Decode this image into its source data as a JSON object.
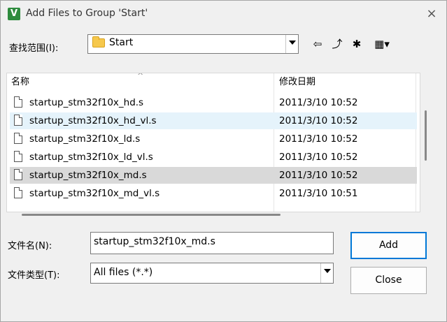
{
  "window": {
    "title": "Add Files to Group 'Start'",
    "app_icon_glyph": "V",
    "close_glyph": "×"
  },
  "lookin": {
    "label": "查找范围(I):",
    "value": "Start"
  },
  "toolbar": {
    "back_glyph": "⇦",
    "up_glyph": "⤴",
    "new_folder_glyph": "✱",
    "views_glyph": "▦▾"
  },
  "list": {
    "columns": {
      "name": "名称",
      "date": "修改日期",
      "sort_glyph": "^"
    },
    "rows": [
      {
        "name": "startup_stm32f10x_hd.s",
        "date": "2011/3/10 10:52"
      },
      {
        "name": "startup_stm32f10x_hd_vl.s",
        "date": "2011/3/10 10:52"
      },
      {
        "name": "startup_stm32f10x_ld.s",
        "date": "2011/3/10 10:52"
      },
      {
        "name": "startup_stm32f10x_ld_vl.s",
        "date": "2011/3/10 10:52"
      },
      {
        "name": "startup_stm32f10x_md.s",
        "date": "2011/3/10 10:52"
      },
      {
        "name": "startup_stm32f10x_md_vl.s",
        "date": "2011/3/10 10:51"
      }
    ]
  },
  "filename": {
    "label": "文件名(N):",
    "value": "startup_stm32f10x_md.s"
  },
  "filetype": {
    "label": "文件类型(T):",
    "value": "All files (*.*)"
  },
  "buttons": {
    "add": "Add",
    "close": "Close"
  },
  "colors": {
    "hover_row": "#e5f3fb",
    "selected_row": "#d9d9d9",
    "default_button_border": "#0078d7"
  }
}
